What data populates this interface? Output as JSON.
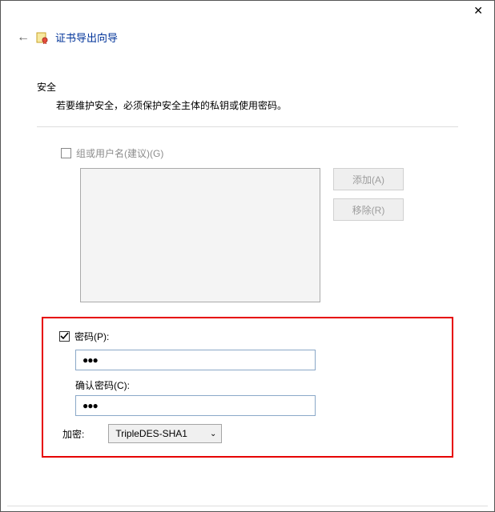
{
  "titlebar": {
    "close": "✕"
  },
  "header": {
    "back": "←",
    "title": "证书导出向导"
  },
  "section": {
    "title": "安全",
    "description": "若要维护安全，必须保护安全主体的私钥或使用密码。"
  },
  "group": {
    "checkbox_label": "组或用户名(建议)(G)",
    "add_btn": "添加(A)",
    "remove_btn": "移除(R)"
  },
  "password": {
    "checkbox_label": "密码(P):",
    "password_value": "●●●",
    "confirm_label": "确认密码(C):",
    "confirm_value": "●●●"
  },
  "encryption": {
    "label": "加密:",
    "selected": "TripleDES-SHA1"
  }
}
